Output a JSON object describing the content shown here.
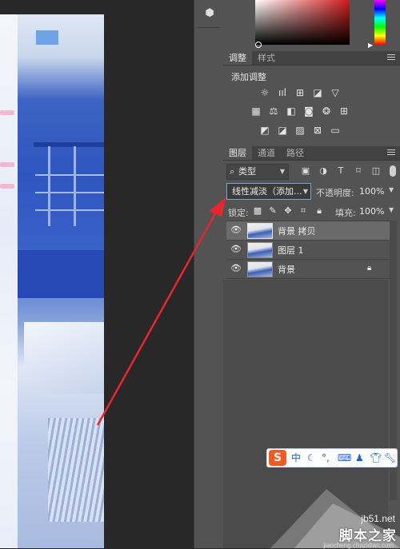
{
  "adjustments_panel": {
    "tabs": [
      "调整",
      "样式"
    ],
    "title": "添加调整",
    "row1_icons": [
      "brightness-contrast-icon",
      "levels-icon",
      "curves-icon",
      "exposure-icon",
      "vibrance-icon"
    ],
    "row2_icons": [
      "hue-saturation-icon",
      "color-balance-icon",
      "black-white-icon",
      "photo-filter-icon",
      "channel-mixer-icon",
      "color-lookup-icon"
    ],
    "row3_icons": [
      "invert-icon",
      "posterize-icon",
      "threshold-icon",
      "selective-color-icon",
      "gradient-map-icon"
    ]
  },
  "layers_panel": {
    "tabs": [
      "图层",
      "通道",
      "路径"
    ],
    "filter": {
      "label": "类型"
    },
    "blend_mode": "线性减淡（添加...",
    "opacity_label": "不透明度:",
    "opacity_value": "100%",
    "lock_label": "锁定:",
    "fill_label": "填充:",
    "fill_value": "100%",
    "layers": [
      {
        "name": "背景 拷贝",
        "selected": true,
        "visible": true,
        "locked": false
      },
      {
        "name": "图层 1",
        "selected": false,
        "visible": true,
        "locked": false
      },
      {
        "name": "背景",
        "selected": false,
        "visible": true,
        "locked": true
      }
    ]
  },
  "ime_toolbar": {
    "logo": "S",
    "mode": "中",
    "items": [
      "moon-icon",
      "punctuation-icon",
      "keyboard-icon",
      "user-icon",
      "skin-icon",
      "wrench-icon"
    ]
  },
  "watermark": {
    "site": "jb51.net",
    "name": "脚本之家",
    "url": "jiaocheng.chazidian.com"
  },
  "colors": {
    "panel_bg": "#535353",
    "canvas_bg": "#282828",
    "selection_blue": "#7ba3d7",
    "arrow_red": "#e8262b"
  }
}
